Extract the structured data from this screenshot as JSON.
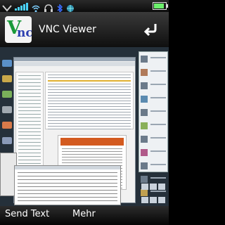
{
  "app": {
    "title": "VNC Viewer",
    "logo_text_main": "V",
    "logo_text_sub": "nc"
  },
  "status_bar": {
    "icons": [
      "downlink-chevron-icon",
      "signal-bars-icon",
      "wifi-icon",
      "headset-icon",
      "bluetooth-icon",
      "globe-icon",
      "battery-icon"
    ],
    "battery_level": 0.75
  },
  "softkeys": {
    "left_label": "Send Text",
    "right_label": "Mehr"
  },
  "remote_view": {
    "description_icon": "remote-desktop-icon"
  },
  "colors": {
    "logo_green": "#1a9a3a",
    "logo_blue": "#2c3fb0",
    "document_heading": "#d35a1f",
    "desktop_background": "#25303a"
  }
}
